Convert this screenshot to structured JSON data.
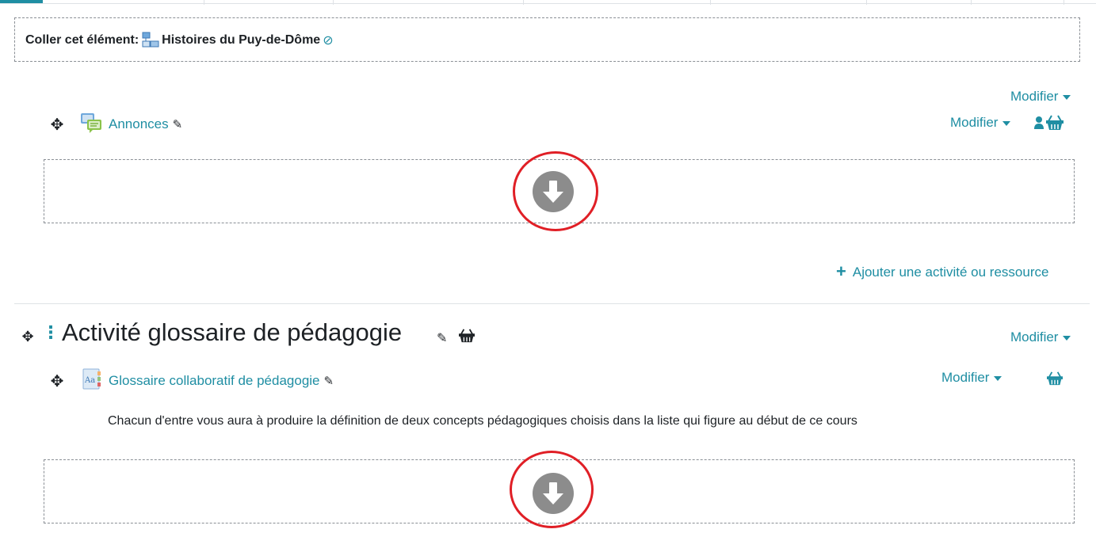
{
  "paste": {
    "label": "Coller cet élément:",
    "item_name": "Histoires du Puy-de-Dôme",
    "cancel_icon": "ban-icon"
  },
  "section0": {
    "edit_menu": "Modifier",
    "activity": {
      "name": "Annonces",
      "edit_menu": "Modifier",
      "icon": "forum-icon"
    },
    "add_activity": "Ajouter une activité ou ressource"
  },
  "section1": {
    "title": "Activité glossaire de pédagogie",
    "edit_menu": "Modifier",
    "activity": {
      "name": "Glossaire collaboratif de pédagogie",
      "edit_menu": "Modifier",
      "icon": "glossary-icon",
      "description": "Chacun d'entre vous aura à produire la définition de deux concepts pédagogiques choisis dans la liste qui figure au début de ce cours"
    }
  },
  "colors": {
    "accent": "#1f8ea3",
    "highlight": "#e01f26",
    "drop_target": "#8c8c8c"
  }
}
